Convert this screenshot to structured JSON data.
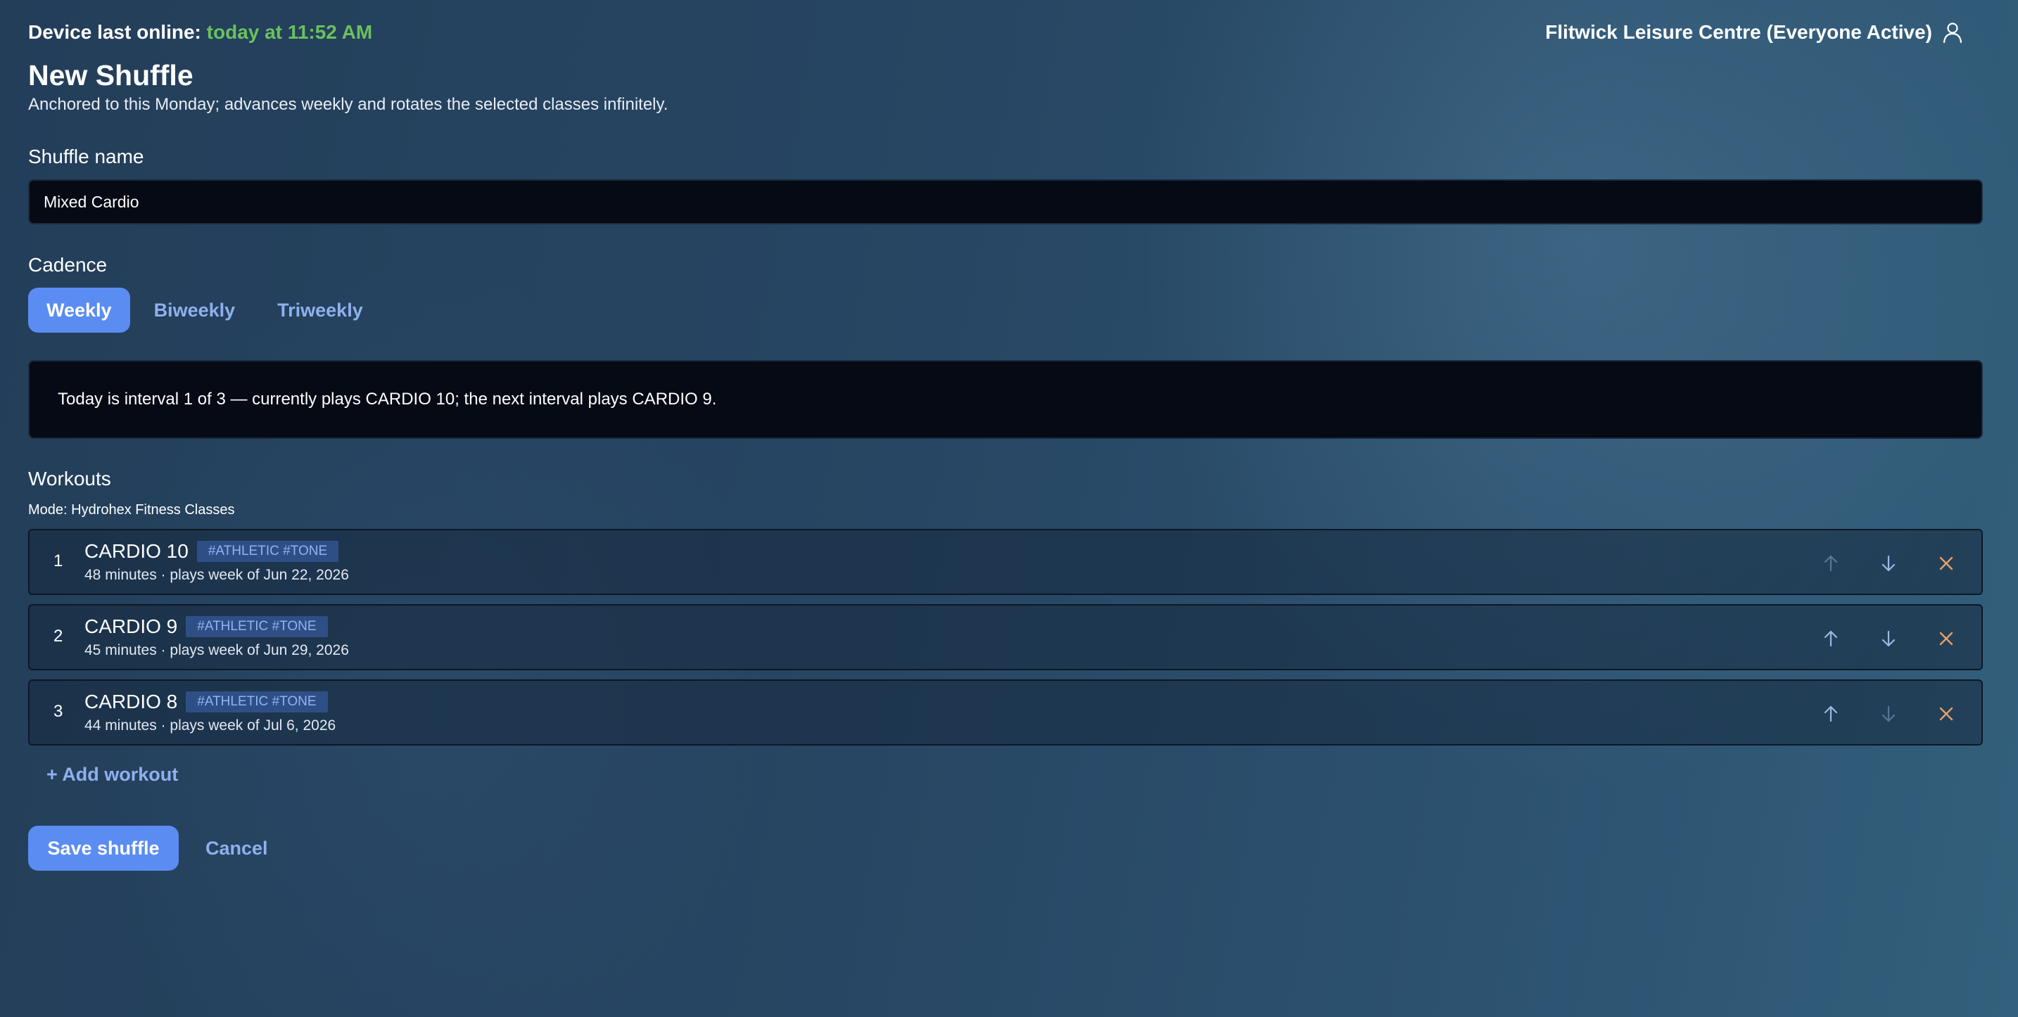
{
  "header": {
    "online_label": "Device last online:",
    "online_time": "today at 11:52 AM",
    "venue": "Flitwick Leisure Centre (Everyone Active)",
    "user_icon": "user-icon"
  },
  "page": {
    "title": "New Shuffle",
    "subtitle": "Anchored to this Monday; advances weekly and rotates the selected classes infinitely."
  },
  "form": {
    "name_label": "Shuffle name",
    "name_value": "Mixed Cardio",
    "cadence_label": "Cadence",
    "cadence_options": [
      "Weekly",
      "Biweekly",
      "Triweekly"
    ],
    "cadence_selected": "Weekly",
    "info": "Today is interval 1 of 3 — currently plays CARDIO 10; the next interval plays CARDIO 9."
  },
  "workouts": {
    "label": "Workouts",
    "mode": "Mode: Hydrohex Fitness Classes",
    "items": [
      {
        "index": "1",
        "name": "CARDIO 10",
        "tags": "#ATHLETIC #TONE",
        "meta": "48 minutes · plays week of Jun 22, 2026",
        "move_up_enabled": false,
        "move_down_enabled": true
      },
      {
        "index": "2",
        "name": "CARDIO 9",
        "tags": "#ATHLETIC #TONE",
        "meta": "45 minutes · plays week of Jun 29, 2026",
        "move_up_enabled": true,
        "move_down_enabled": true
      },
      {
        "index": "3",
        "name": "CARDIO 8",
        "tags": "#ATHLETIC #TONE",
        "meta": "44 minutes · plays week of Jul 6, 2026",
        "move_up_enabled": true,
        "move_down_enabled": false
      }
    ],
    "add_label": "+ Add workout",
    "icons": {
      "up": "arrow-up-icon",
      "down": "arrow-down-icon",
      "remove": "close-icon"
    }
  },
  "actions": {
    "save": "Save shuffle",
    "cancel": "Cancel"
  },
  "colors": {
    "accent": "#5b8cf2",
    "link": "#8fb0ee",
    "online": "#6ac15d",
    "remove": "#e9a06a",
    "arrow": "#9fb8e2",
    "field_bg": "#050a14",
    "tag_bg": "#2e4f86"
  }
}
